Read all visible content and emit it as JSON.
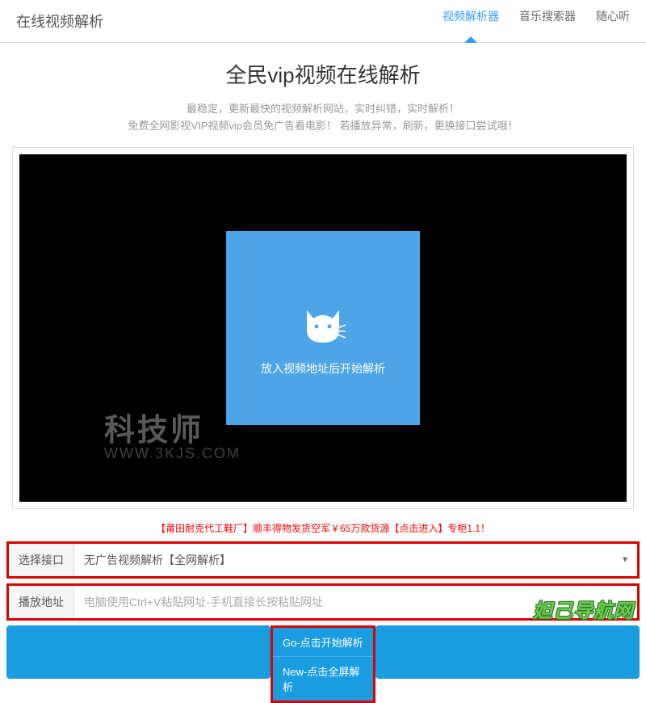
{
  "header": {
    "logo": "在线视频解析",
    "nav": [
      {
        "label": "视频解析器",
        "active": true
      },
      {
        "label": "音乐搜索器",
        "active": false
      },
      {
        "label": "随心听",
        "active": false
      }
    ]
  },
  "title": "全民vip视频在线解析",
  "subtitle_line1": "最稳定，更新最快的视频解析网站，实时纠错，实时解析！",
  "subtitle_line2": "免费全网影视VIP视频vip会员免广告看电影！ 若播放异常，刷新，更换接口尝试哦！",
  "video": {
    "placeholder_text": "放入视频地址后开始解析"
  },
  "watermark": {
    "main": "科技师",
    "url": "WWW.3KJS.COM"
  },
  "promo": "【莆田耐克代工鞋厂】顺丰得物发货空军￥65万款货源【点击进入】专柜1.1！",
  "form": {
    "interface_label": "选择接口",
    "interface_value": "无广告视频解析【全网解析】",
    "url_label": "播放地址",
    "url_placeholder": "电脑使用Ctrl+V粘贴网址-手机直接长按粘贴网址"
  },
  "buttons": {
    "go": "Go-点击开始解析",
    "new": "New-点击全屏解析"
  },
  "footer_watermark": "妲己导航网"
}
